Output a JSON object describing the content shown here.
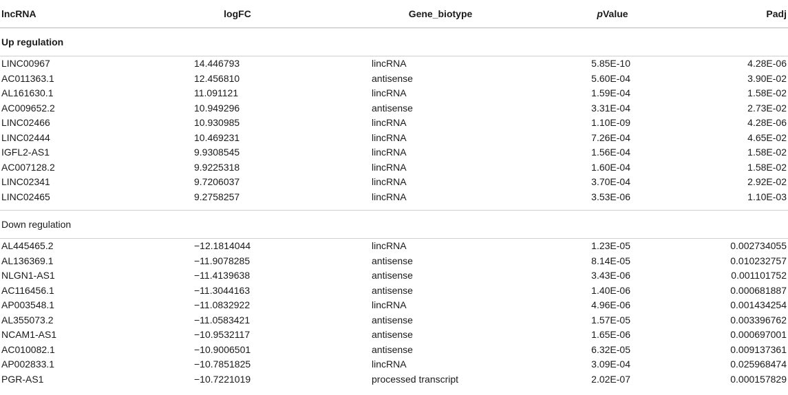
{
  "table": {
    "headers": [
      "lncRNA",
      "logFC",
      "Gene_biotype",
      "pValue",
      "Padj"
    ],
    "groups": [
      {
        "label": "Up regulation",
        "rows": [
          [
            "LINC00967",
            "14.446793",
            "lincRNA",
            "5.85E-10",
            "4.28E-06"
          ],
          [
            "AC011363.1",
            "12.456810",
            "antisense",
            "5.60E-04",
            "3.90E-02"
          ],
          [
            "AL161630.1",
            "11.091121",
            "lincRNA",
            "1.59E-04",
            "1.58E-02"
          ],
          [
            "AC009652.2",
            "10.949296",
            "antisense",
            "3.31E-04",
            "2.73E-02"
          ],
          [
            "LINC02466",
            "10.930985",
            "lincRNA",
            "1.10E-09",
            "4.28E-06"
          ],
          [
            "LINC02444",
            "10.469231",
            "lincRNA",
            "7.26E-04",
            "4.65E-02"
          ],
          [
            "IGFL2-AS1",
            "9.9308545",
            "lincRNA",
            "1.56E-04",
            "1.58E-02"
          ],
          [
            "AC007128.2",
            "9.9225318",
            "lincRNA",
            "1.60E-04",
            "1.58E-02"
          ],
          [
            "LINC02341",
            "9.7206037",
            "lincRNA",
            "3.70E-04",
            "2.92E-02"
          ],
          [
            "LINC02465",
            "9.2758257",
            "lincRNA",
            "3.53E-06",
            "1.10E-03"
          ]
        ]
      },
      {
        "label": "Down regulation",
        "rows": [
          [
            "AL445465.2",
            "−12.1814044",
            "lincRNA",
            "1.23E-05",
            "0.002734055"
          ],
          [
            "AL136369.1",
            "−11.9078285",
            "antisense",
            "8.14E-05",
            "0.010232757"
          ],
          [
            "NLGN1-AS1",
            "−11.4139638",
            "antisense",
            "3.43E-06",
            "0.001101752"
          ],
          [
            "AC116456.1",
            "−11.3044163",
            "antisense",
            "1.40E-06",
            "0.000681887"
          ],
          [
            "AP003548.1",
            "−11.0832922",
            "lincRNA",
            "4.96E-06",
            "0.001434254"
          ],
          [
            "AL355073.2",
            "−11.0583421",
            "antisense",
            "1.57E-05",
            "0.003396762"
          ],
          [
            "NCAM1-AS1",
            "−10.9532117",
            "antisense",
            "1.65E-06",
            "0.000697001"
          ],
          [
            "AC010082.1",
            "−10.9006501",
            "antisense",
            "6.32E-05",
            "0.009137361"
          ],
          [
            "AP002833.1",
            "−10.7851825",
            "lincRNA",
            "3.09E-04",
            "0.025968474"
          ],
          [
            "PGR-AS1",
            "−10.7221019",
            "processed transcript",
            "2.02E-07",
            "0.000157829"
          ]
        ]
      }
    ]
  }
}
